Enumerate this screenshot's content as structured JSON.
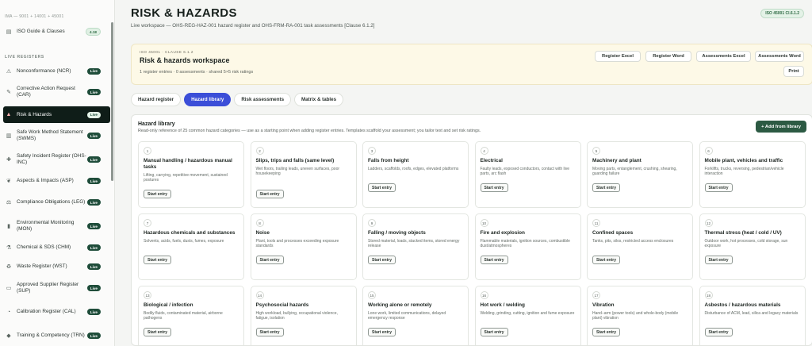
{
  "sidebar": {
    "crumb": "IMA — 9001 + 14001 + 45001",
    "top_item": {
      "label": "ISO Guide & Clauses",
      "badge": "4.18",
      "icon": "book-icon"
    },
    "section_label": "LIVE REGISTERS",
    "items": [
      {
        "label": "Nonconformance (NCR)",
        "badge": "Live",
        "icon": "warning-icon"
      },
      {
        "label": "Corrective Action Request (CAR)",
        "badge": "Live",
        "icon": "wrench-icon"
      },
      {
        "label": "Risk & Hazards",
        "badge": "Live",
        "icon": "alert-icon",
        "active": true
      },
      {
        "label": "Safe Work Method Statement (SWMS)",
        "badge": "Live",
        "icon": "clipboard-icon"
      },
      {
        "label": "Safety Incident Register (OHS-INC)",
        "badge": "Live",
        "icon": "ambulance-icon"
      },
      {
        "label": "Aspects & Impacts (ASP)",
        "badge": "Live",
        "icon": "leaf-icon"
      },
      {
        "label": "Compliance Obligations (LEG)",
        "badge": "Live",
        "icon": "scale-icon"
      },
      {
        "label": "Environmental Monitoring (MON)",
        "badge": "Live",
        "icon": "chart-icon"
      },
      {
        "label": "Chemical & SDS (CHM)",
        "badge": "Live",
        "icon": "flask-icon"
      },
      {
        "label": "Waste Register (WST)",
        "badge": "Live",
        "icon": "recycle-icon"
      },
      {
        "label": "Approved Supplier Register (SUP)",
        "badge": "Live",
        "icon": "truck-icon"
      },
      {
        "label": "Calibration Register (CAL)",
        "badge": "Live",
        "icon": "gauge-icon"
      },
      {
        "label": "Training & Competency (TRN)",
        "badge": "Live",
        "icon": "cap-icon"
      }
    ]
  },
  "header": {
    "title": "RISK & HAZARDS",
    "subtitle": "Live workspace — OHS-REG-HAZ-001 hazard register and OHS-FRM-RA-001 task assessments [Clause 6.1.2]",
    "iso_badge": "ISO 45001 Cl.6.1.2"
  },
  "workspace": {
    "kicker": "ISO 45001 · CLAUSE 6.1.2",
    "title": "Risk & hazards workspace",
    "meta": "1 register entries · 0 assessments · shared 5×5 risk ratings",
    "buttons": [
      "Register Excel",
      "Register Word",
      "Assessments Excel",
      "Assessments Word"
    ],
    "print": "Print"
  },
  "tabs": [
    {
      "label": "Hazard register",
      "active": false
    },
    {
      "label": "Hazard library",
      "active": true
    },
    {
      "label": "Risk assessments",
      "active": false
    },
    {
      "label": "Matrix & tables",
      "active": false
    }
  ],
  "library": {
    "title": "Hazard library",
    "description": "Read-only reference of 25 common hazard categories — use as a starting point when adding register entries. Templates scaffold your assessment; you tailor text and set risk ratings.",
    "add_button": "+ Add from library",
    "start_label": "Start entry",
    "cards": [
      {
        "num": "1",
        "name": "Manual handling / hazardous manual tasks",
        "desc": "Lifting, carrying, repetitive movement, sustained postures"
      },
      {
        "num": "2",
        "name": "Slips, trips and falls (same level)",
        "desc": "Wet floors, trailing leads, uneven surfaces, poor housekeeping"
      },
      {
        "num": "3",
        "name": "Falls from height",
        "desc": "Ladders, scaffolds, roofs, edges, elevated platforms"
      },
      {
        "num": "4",
        "name": "Electrical",
        "desc": "Faulty leads, exposed conductors, contact with live parts, arc flash"
      },
      {
        "num": "5",
        "name": "Machinery and plant",
        "desc": "Moving parts, entanglement, crushing, shearing, guarding failure"
      },
      {
        "num": "6",
        "name": "Mobile plant, vehicles and traffic",
        "desc": "Forklifts, trucks, reversing, pedestrian/vehicle interaction"
      },
      {
        "num": "7",
        "name": "Hazardous chemicals and substances",
        "desc": "Solvents, acids, fuels, dusts, fumes, exposure"
      },
      {
        "num": "8",
        "name": "Noise",
        "desc": "Plant, tools and processes exceeding exposure standards"
      },
      {
        "num": "9",
        "name": "Falling / moving objects",
        "desc": "Stored material, loads, stacked items, stored energy release"
      },
      {
        "num": "10",
        "name": "Fire and explosion",
        "desc": "Flammable materials, ignition sources, combustible dust/atmospheres"
      },
      {
        "num": "11",
        "name": "Confined spaces",
        "desc": "Tanks, pits, silos, restricted access enclosures"
      },
      {
        "num": "12",
        "name": "Thermal stress (heat / cold / UV)",
        "desc": "Outdoor work, hot processes, cold storage, sun exposure"
      },
      {
        "num": "13",
        "name": "Biological / infection",
        "desc": "Bodily fluids, contaminated material, airborne pathogens"
      },
      {
        "num": "14",
        "name": "Psychosocial hazards",
        "desc": "High workload, bullying, occupational violence, fatigue, isolation"
      },
      {
        "num": "15",
        "name": "Working alone or remotely",
        "desc": "Lone work, limited communications, delayed emergency response"
      },
      {
        "num": "16",
        "name": "Hot work / welding",
        "desc": "Welding, grinding, cutting, ignition and fume exposure"
      },
      {
        "num": "17",
        "name": "Vibration",
        "desc": "Hand–arm (power tools) and whole-body (mobile plant) vibration"
      },
      {
        "num": "18",
        "name": "Asbestos / hazardous materials",
        "desc": "Disturbance of ACM, lead, silica and legacy materials"
      }
    ]
  }
}
